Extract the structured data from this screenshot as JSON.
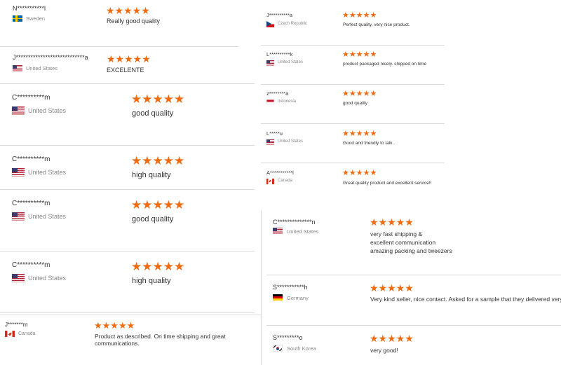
{
  "reviews": [
    {
      "name": "N***********l",
      "flag": "sweden-flag-icon",
      "country": "Sweden",
      "stars": "★★★★★",
      "text": "Really good quality"
    },
    {
      "name": "J****************************a",
      "flag": "us-flag-icon",
      "country": "United States",
      "stars": "★★★★★",
      "text": "EXCELENTE"
    },
    {
      "name": "C**********m",
      "flag": "us-flag-icon",
      "country": "United States",
      "stars": "★★★★★",
      "text": "good quality"
    },
    {
      "name": "C**********m",
      "flag": "us-flag-icon",
      "country": "United States",
      "stars": "★★★★★",
      "text": "high quality"
    },
    {
      "name": "C**********m",
      "flag": "us-flag-icon",
      "country": "United States",
      "stars": "★★★★★",
      "text": "good quality"
    },
    {
      "name": "C**********m",
      "flag": "us-flag-icon",
      "country": "United States",
      "stars": "★★★★★",
      "text": "high quality"
    },
    {
      "name": "J*******m",
      "flag": "canada-flag-icon",
      "country": "Canada",
      "stars": "★★★★★",
      "text": "Product as described. On time shipping and great communications."
    },
    {
      "name": "J**********a",
      "flag": "czech-flag-icon",
      "country": "Czech Republic",
      "stars": "★★★★★",
      "text": "Perfect quality, very nice product."
    },
    {
      "name": "L**********k",
      "flag": "us-flag-icon",
      "country": "United States",
      "stars": "★★★★★",
      "text": "product packaged nicely. shipped on time"
    },
    {
      "name": "z********a",
      "flag": "indonesia-flag-icon",
      "country": "Indonesia",
      "stars": "★★★★★",
      "text": "good quality"
    },
    {
      "name": "L*****u",
      "flag": "us-flag-icon",
      "country": "United States",
      "stars": "★★★★★",
      "text": "Good and friendly to talk ."
    },
    {
      "name": "A***********l",
      "flag": "canada-flag-icon",
      "country": "Canada",
      "stars": "★★★★★",
      "text": "Great quality product and excellent service!!"
    },
    {
      "name": "C**************n",
      "flag": "us-flag-icon",
      "country": "United States",
      "stars": "★★★★★",
      "text": "very fast shipping &\nexcellent communication\namazing packing and tweezers"
    },
    {
      "name": "S***********h",
      "flag": "germany-flag-icon",
      "country": "Germany",
      "stars": "★★★★★",
      "text": "Very kind seller, nice contact. Asked for a sample that they delivered very"
    },
    {
      "name": "S*********o",
      "flag": "south-korea-flag-icon",
      "country": "South Korea",
      "stars": "★★★★★",
      "text": "very good!"
    }
  ]
}
